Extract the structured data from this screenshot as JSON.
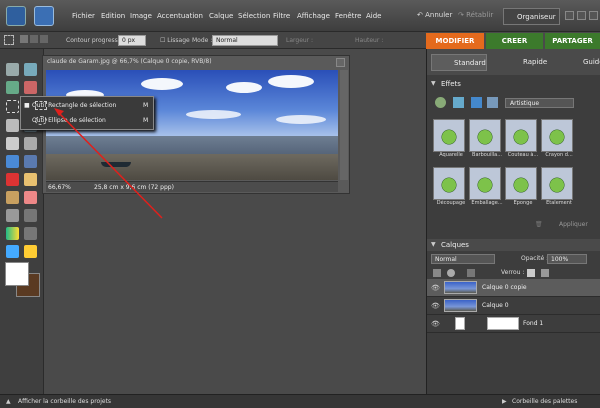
{
  "menu": {
    "items": [
      "Fichier",
      "Edition",
      "Image",
      "Accentuation",
      "Calque",
      "Sélection",
      "Filtre",
      "Affichage",
      "Fenêtre",
      "Aide"
    ],
    "undo": "Annuler",
    "redo": "Rétablir",
    "organizer": "Organiseur"
  },
  "options_bar": {
    "feather_label": "Contour progressif :",
    "feather_value": "0 px",
    "antialias_label": "Lissage",
    "mode_label": "Mode :",
    "mode_value": "Normal",
    "width_label": "Largeur :",
    "height_label": "Hauteur :"
  },
  "mode_tabs": [
    "MODIFIER",
    "CREER",
    "PARTAGER"
  ],
  "document": {
    "title": "claude de Garam.jpg @ 66,7% (Calque 0 copie, RVB/8)",
    "zoom": "66,67%",
    "size": "25,8 cm x 9,6 cm (72 ppp)"
  },
  "flyout": [
    {
      "label": "Outil Rectangle de sélection",
      "shortcut": "M"
    },
    {
      "label": "Outil Ellipse de sélection",
      "shortcut": "M"
    }
  ],
  "panel": {
    "subtabs": [
      "Standard",
      "Rapide",
      "Guidé"
    ],
    "effects_title": "Effets",
    "effects_category": "Artistique",
    "effects": [
      "Aquarelle",
      "Barbouilla...",
      "Couteau à...",
      "Crayon d...",
      "Découpage",
      "Emballage...",
      "Eponge",
      "Etalement"
    ],
    "apply": "Appliquer",
    "layers_title": "Calques",
    "blend_mode": "Normal",
    "opacity_label": "Opacité :",
    "opacity_value": "100%",
    "lock_label": "Verrou :",
    "layers": [
      "Calque 0 copie",
      "Calque 0",
      "Fond 1"
    ]
  },
  "bottom": {
    "left": "Afficher la corbeille des projets",
    "right": "Corbeille des palettes"
  },
  "colors": {
    "accent_orange": "#e46a1d",
    "tab_green": "#3c7a2c",
    "annotation_red": "#e0201c"
  }
}
